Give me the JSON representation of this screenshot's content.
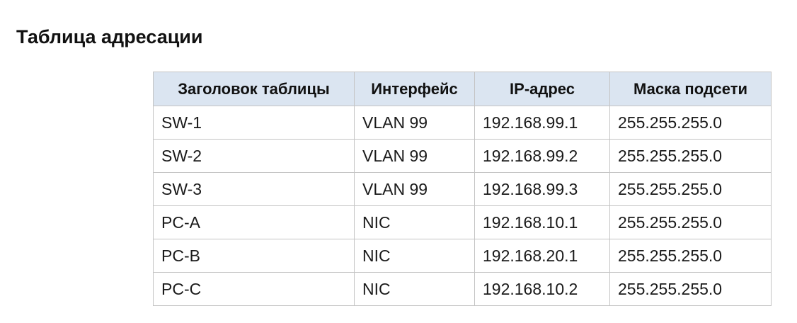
{
  "page": {
    "title": "Таблица адресации"
  },
  "table": {
    "columns": [
      "Заголовок таблицы",
      "Интерфейс",
      "IP-адрес",
      "Маска подсети"
    ],
    "header_bg": "#dbe5f1",
    "rows": [
      [
        "SW-1",
        "VLAN 99",
        "192.168.99.1",
        "255.255.255.0"
      ],
      [
        "SW-2",
        "VLAN 99",
        "192.168.99.2",
        "255.255.255.0"
      ],
      [
        "SW-3",
        "VLAN 99",
        "192.168.99.3",
        "255.255.255.0"
      ],
      [
        "PC-A",
        "NIC",
        "192.168.10.1",
        "255.255.255.0"
      ],
      [
        "PC-B",
        "NIC",
        "192.168.20.1",
        "255.255.255.0"
      ],
      [
        "PC-C",
        "NIC",
        "192.168.10.2",
        "255.255.255.0"
      ]
    ]
  }
}
